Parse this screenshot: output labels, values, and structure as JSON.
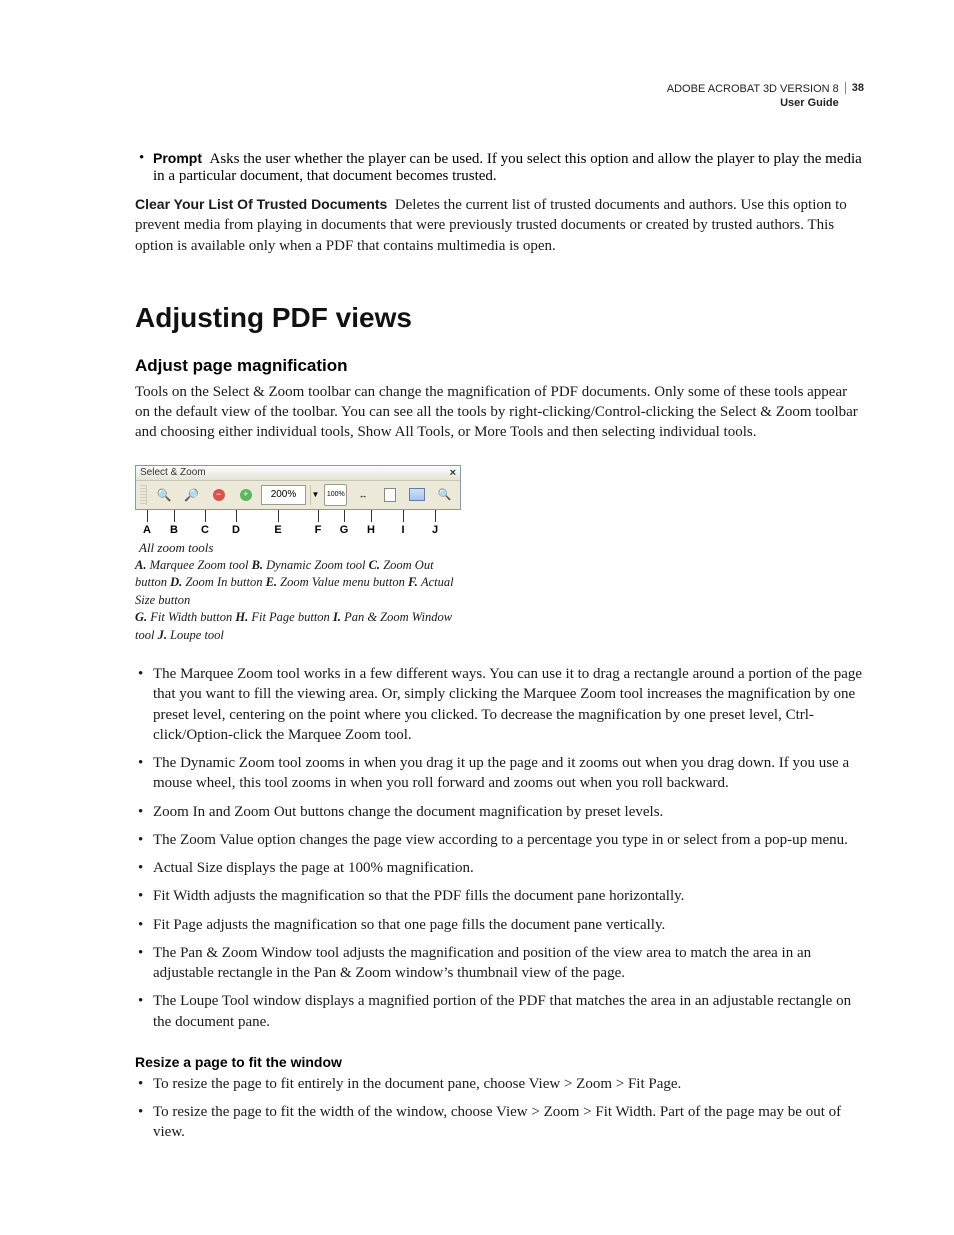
{
  "header": {
    "product": "ADOBE ACROBAT 3D VERSION 8",
    "doc": "User Guide",
    "page_number": "38"
  },
  "prompt": {
    "label": "Prompt",
    "text": "Asks the user whether the player can be used. If you select this option and allow the player to play the media in a particular document, that document becomes trusted."
  },
  "clear": {
    "label": "Clear Your List Of Trusted Documents",
    "text": "Deletes the current list of trusted documents and authors. Use this option to prevent media from playing in documents that were previously trusted documents or created by trusted authors. This option is available only when a PDF that contains multimedia is open."
  },
  "section_title": "Adjusting PDF views",
  "sub1": {
    "title": "Adjust page magnification",
    "intro": "Tools on the Select & Zoom toolbar can change the magnification of PDF documents. Only some of these tools appear on the default view of the toolbar. You can see all the tools by right-clicking/Control-clicking the Select & Zoom toolbar and choosing either individual tools, Show All Tools, or More Tools and then selecting individual tools."
  },
  "figure": {
    "toolbar_title": "Select & Zoom",
    "zoom_value": "200%",
    "actual_size_label": "100%",
    "caption": "All zoom tools",
    "callouts": [
      "A",
      "B",
      "C",
      "D",
      "E",
      "F",
      "G",
      "H",
      "I",
      "J"
    ],
    "callout_offsets": [
      24,
      30,
      32,
      30,
      54,
      26,
      26,
      28,
      36,
      28
    ],
    "legend": [
      {
        "k": "A.",
        "t": "Marquee Zoom tool"
      },
      {
        "k": "B.",
        "t": "Dynamic Zoom tool"
      },
      {
        "k": "C.",
        "t": "Zoom Out button"
      },
      {
        "k": "D.",
        "t": "Zoom In button"
      },
      {
        "k": "E.",
        "t": "Zoom Value menu button"
      },
      {
        "k": "F.",
        "t": "Actual Size button"
      },
      {
        "k": "G.",
        "t": "Fit Width button"
      },
      {
        "k": "H.",
        "t": "Fit Page button"
      },
      {
        "k": "I.",
        "t": "Pan & Zoom Window tool"
      },
      {
        "k": "J.",
        "t": "Loupe tool"
      }
    ]
  },
  "bullets": [
    "The Marquee Zoom tool works in a few different ways. You can use it to drag a rectangle around a portion of the page that you want to fill the viewing area. Or, simply clicking the Marquee Zoom tool increases the magnification by one preset level, centering on the point where you clicked. To decrease the magnification by one preset level, Ctrl-click/Option-click the Marquee Zoom tool.",
    "The Dynamic Zoom tool zooms in when you drag it up the page and it zooms out when you drag down. If you use a mouse wheel, this tool zooms in when you roll forward and zooms out when you roll backward.",
    " Zoom In and Zoom Out buttons change the document magnification by preset levels.",
    "The Zoom Value option changes the page view according to a percentage you type in or select from a pop-up menu.",
    "Actual Size displays the page at 100% magnification.",
    "Fit Width adjusts the magnification so that the PDF fills the document pane horizontally.",
    "Fit Page adjusts the magnification so that one page fills the document pane vertically.",
    "The Pan & Zoom Window tool adjusts the magnification and position of the view area to match the area in an adjustable rectangle in the Pan & Zoom window’s thumbnail view of the page.",
    "The Loupe Tool window displays a magnified portion of the PDF that matches the area in an adjustable rectangle on the document pane."
  ],
  "sub2": {
    "title": "Resize a page to fit the window",
    "bullets": [
      "To resize the page to fit entirely in the document pane, choose View > Zoom > Fit Page.",
      "To resize the page to fit the width of the window, choose View > Zoom > Fit Width. Part of the page may be out of view."
    ]
  }
}
